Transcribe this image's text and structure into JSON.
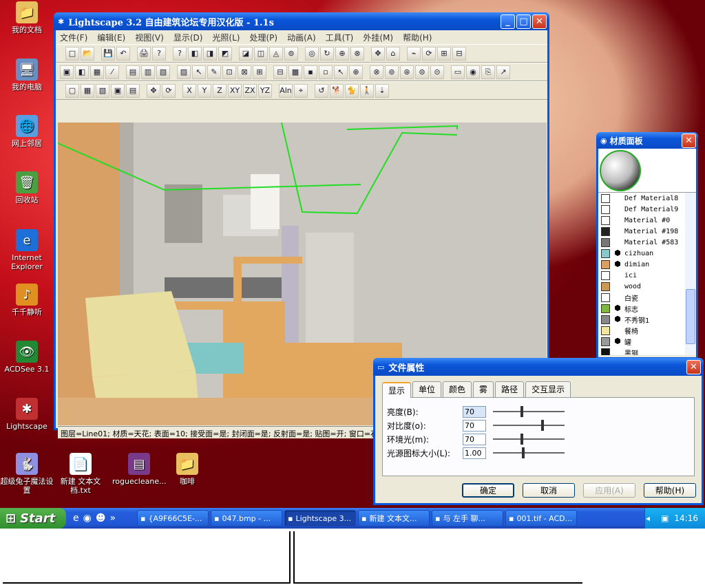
{
  "desktop_icons": [
    {
      "label": "我的文档",
      "icon": "folder-documents-icon",
      "glyph": "📁"
    },
    {
      "label": "我的电脑",
      "icon": "computer-icon",
      "glyph": "🖥"
    },
    {
      "label": "网上邻居",
      "icon": "network-icon",
      "glyph": "🌐"
    },
    {
      "label": "回收站",
      "icon": "recycle-bin-icon",
      "glyph": "🗑"
    },
    {
      "label": "Internet Explorer",
      "icon": "ie-icon",
      "glyph": "e"
    },
    {
      "label": "千千静听",
      "icon": "music-player-icon",
      "glyph": "♪"
    },
    {
      "label": "ACDSee 3.1",
      "icon": "acdsee-icon",
      "glyph": "👁"
    },
    {
      "label": "Lightscape",
      "icon": "lightscape-icon",
      "glyph": "✱"
    },
    {
      "label": "超级兔子魔法设置",
      "icon": "rabbit-icon",
      "glyph": "🐇"
    },
    {
      "label": "新建 文本文档.txt",
      "icon": "text-file-icon",
      "glyph": "📄"
    },
    {
      "label": "roguecleane...",
      "icon": "archive-icon",
      "glyph": "▤"
    },
    {
      "label": "咖啡",
      "icon": "folder-icon",
      "glyph": "📁"
    }
  ],
  "main_window": {
    "title": "Lightscape 3.2 自由建筑论坛专用汉化版  - 1.1s",
    "menus": [
      "文件(F)",
      "编辑(E)",
      "视图(V)",
      "显示(D)",
      "光照(L)",
      "处理(P)",
      "动画(A)",
      "工具(T)",
      "外挂(M)",
      "帮助(H)"
    ],
    "status": "图层=Line01; 材质=天花; 表面=10; 接受面=是; 封闭面=是; 反射面=是; 贴图=开; 窗口=石"
  },
  "toolbar1": [
    "□",
    "📂",
    "💾",
    "↶",
    "🖨",
    "?",
    "?",
    "◧",
    "◨",
    "◩",
    "◪",
    "◫",
    "◬",
    "⊚",
    "◎",
    "↻",
    "⊕",
    "⊗",
    "✥",
    "⌂",
    "⌁",
    "⟳",
    "⊞",
    "⊟"
  ],
  "toolbar2": [
    "▣",
    "◧",
    "▦",
    "⁄",
    "▤",
    "▥",
    "▧",
    "▨",
    "↖",
    "✎",
    "⊡",
    "⊠",
    "⊞",
    "⊟",
    "▩",
    "▪",
    "▫",
    "↖",
    "⊕",
    "⊗",
    "⊚",
    "⊛",
    "⊜",
    "⊝",
    "▭",
    "◉",
    "⎘",
    "↗"
  ],
  "toolbar3": [
    "▢",
    "▦",
    "▧",
    "▣",
    "▤",
    "✥",
    "⟳",
    "X",
    "Y",
    "Z",
    "XY",
    "ZX",
    "YZ",
    "Aln",
    "⌖",
    "↺",
    "🐕",
    "🐈",
    "🚶",
    "⇣"
  ],
  "material_panel": {
    "title": "材质面板",
    "items": [
      {
        "name": "Def Material8",
        "color": "#ffffff",
        "cube": false
      },
      {
        "name": "Def Material9",
        "color": "#ffffff",
        "cube": false
      },
      {
        "name": "Material #0",
        "color": "#ffffff",
        "cube": false
      },
      {
        "name": "Material #198",
        "color": "#222222",
        "cube": false
      },
      {
        "name": "Material #583",
        "color": "#777777",
        "cube": false
      },
      {
        "name": "cizhuan",
        "color": "#88c8c8",
        "cube": true
      },
      {
        "name": "dimian",
        "color": "#d9a066",
        "cube": true
      },
      {
        "name": "ici",
        "color": "#ffffff",
        "cube": false
      },
      {
        "name": "wood",
        "color": "#cc9955",
        "cube": false
      },
      {
        "name": "白瓷",
        "color": "#ffffff",
        "cube": false
      },
      {
        "name": "标志",
        "color": "#7fb840",
        "cube": true
      },
      {
        "name": "不秀钢1",
        "color": "#888888",
        "cube": true
      },
      {
        "name": "餐椅",
        "color": "#f0e6a0",
        "cube": false
      },
      {
        "name": "罐",
        "color": "#999999",
        "cube": true
      },
      {
        "name": "黑钢",
        "color": "#111111",
        "cube": false
      }
    ]
  },
  "file_props": {
    "title": "文件属性",
    "tabs": [
      "显示",
      "单位",
      "颜色",
      "雾",
      "路径",
      "交互显示"
    ],
    "rows": [
      {
        "label": "亮度(B):",
        "value": "70",
        "slider": 0.4
      },
      {
        "label": "对比度(o):",
        "value": "70",
        "slider": 0.7
      },
      {
        "label": "环境光(m):",
        "value": "70",
        "slider": 0.4
      },
      {
        "label": "光源图标大小(L):",
        "value": "1.00",
        "slider": 0.42
      }
    ],
    "buttons": {
      "ok": "确定",
      "cancel": "取消",
      "apply": "应用(A)",
      "help": "帮助(H)"
    }
  },
  "taskbar": {
    "start": "Start",
    "tasks": [
      "{A9F66C5E-...",
      "047.bmp - ...",
      "Lightscape 3...",
      "新建 文本文...",
      "与 左手 聊...",
      "001.tif - ACD..."
    ],
    "clock": "14:16"
  }
}
